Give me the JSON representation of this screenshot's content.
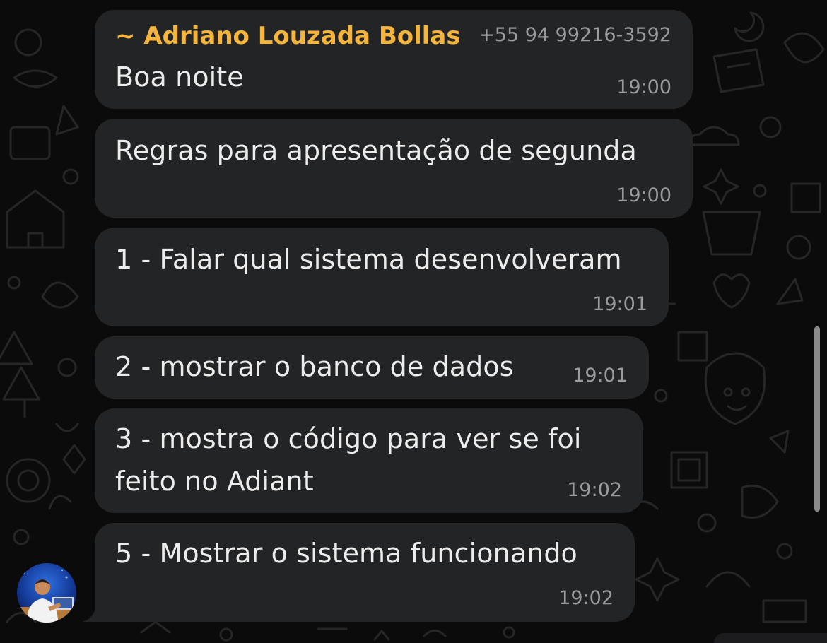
{
  "sender": {
    "name": "~ Adriano Louzada Bollas",
    "phone": "+55 94 99216-3592",
    "name_color": "#f5b43c",
    "avatar_icon": "person-avatar-icon"
  },
  "messages": [
    {
      "lines": [
        "Boa noite"
      ],
      "time": "19:00"
    },
    {
      "lines": [
        "Regras para apresentação de segunda"
      ],
      "time": "19:00"
    },
    {
      "lines": [
        "1 - Falar qual sistema desenvolveram"
      ],
      "time": "19:01"
    },
    {
      "lines": [
        "2 - mostrar o banco de dados"
      ],
      "time": "19:01"
    },
    {
      "lines": [
        "3 - mostra o código para ver se foi",
        "feito no Adiant"
      ],
      "time": "19:02"
    },
    {
      "lines": [
        "5 - Mostrar o sistema funcionando"
      ],
      "time": "19:02"
    }
  ],
  "colors": {
    "background": "#0b0b0b",
    "bubble": "#232425",
    "text": "#ececec",
    "timestamp": "#9a9b9c"
  }
}
